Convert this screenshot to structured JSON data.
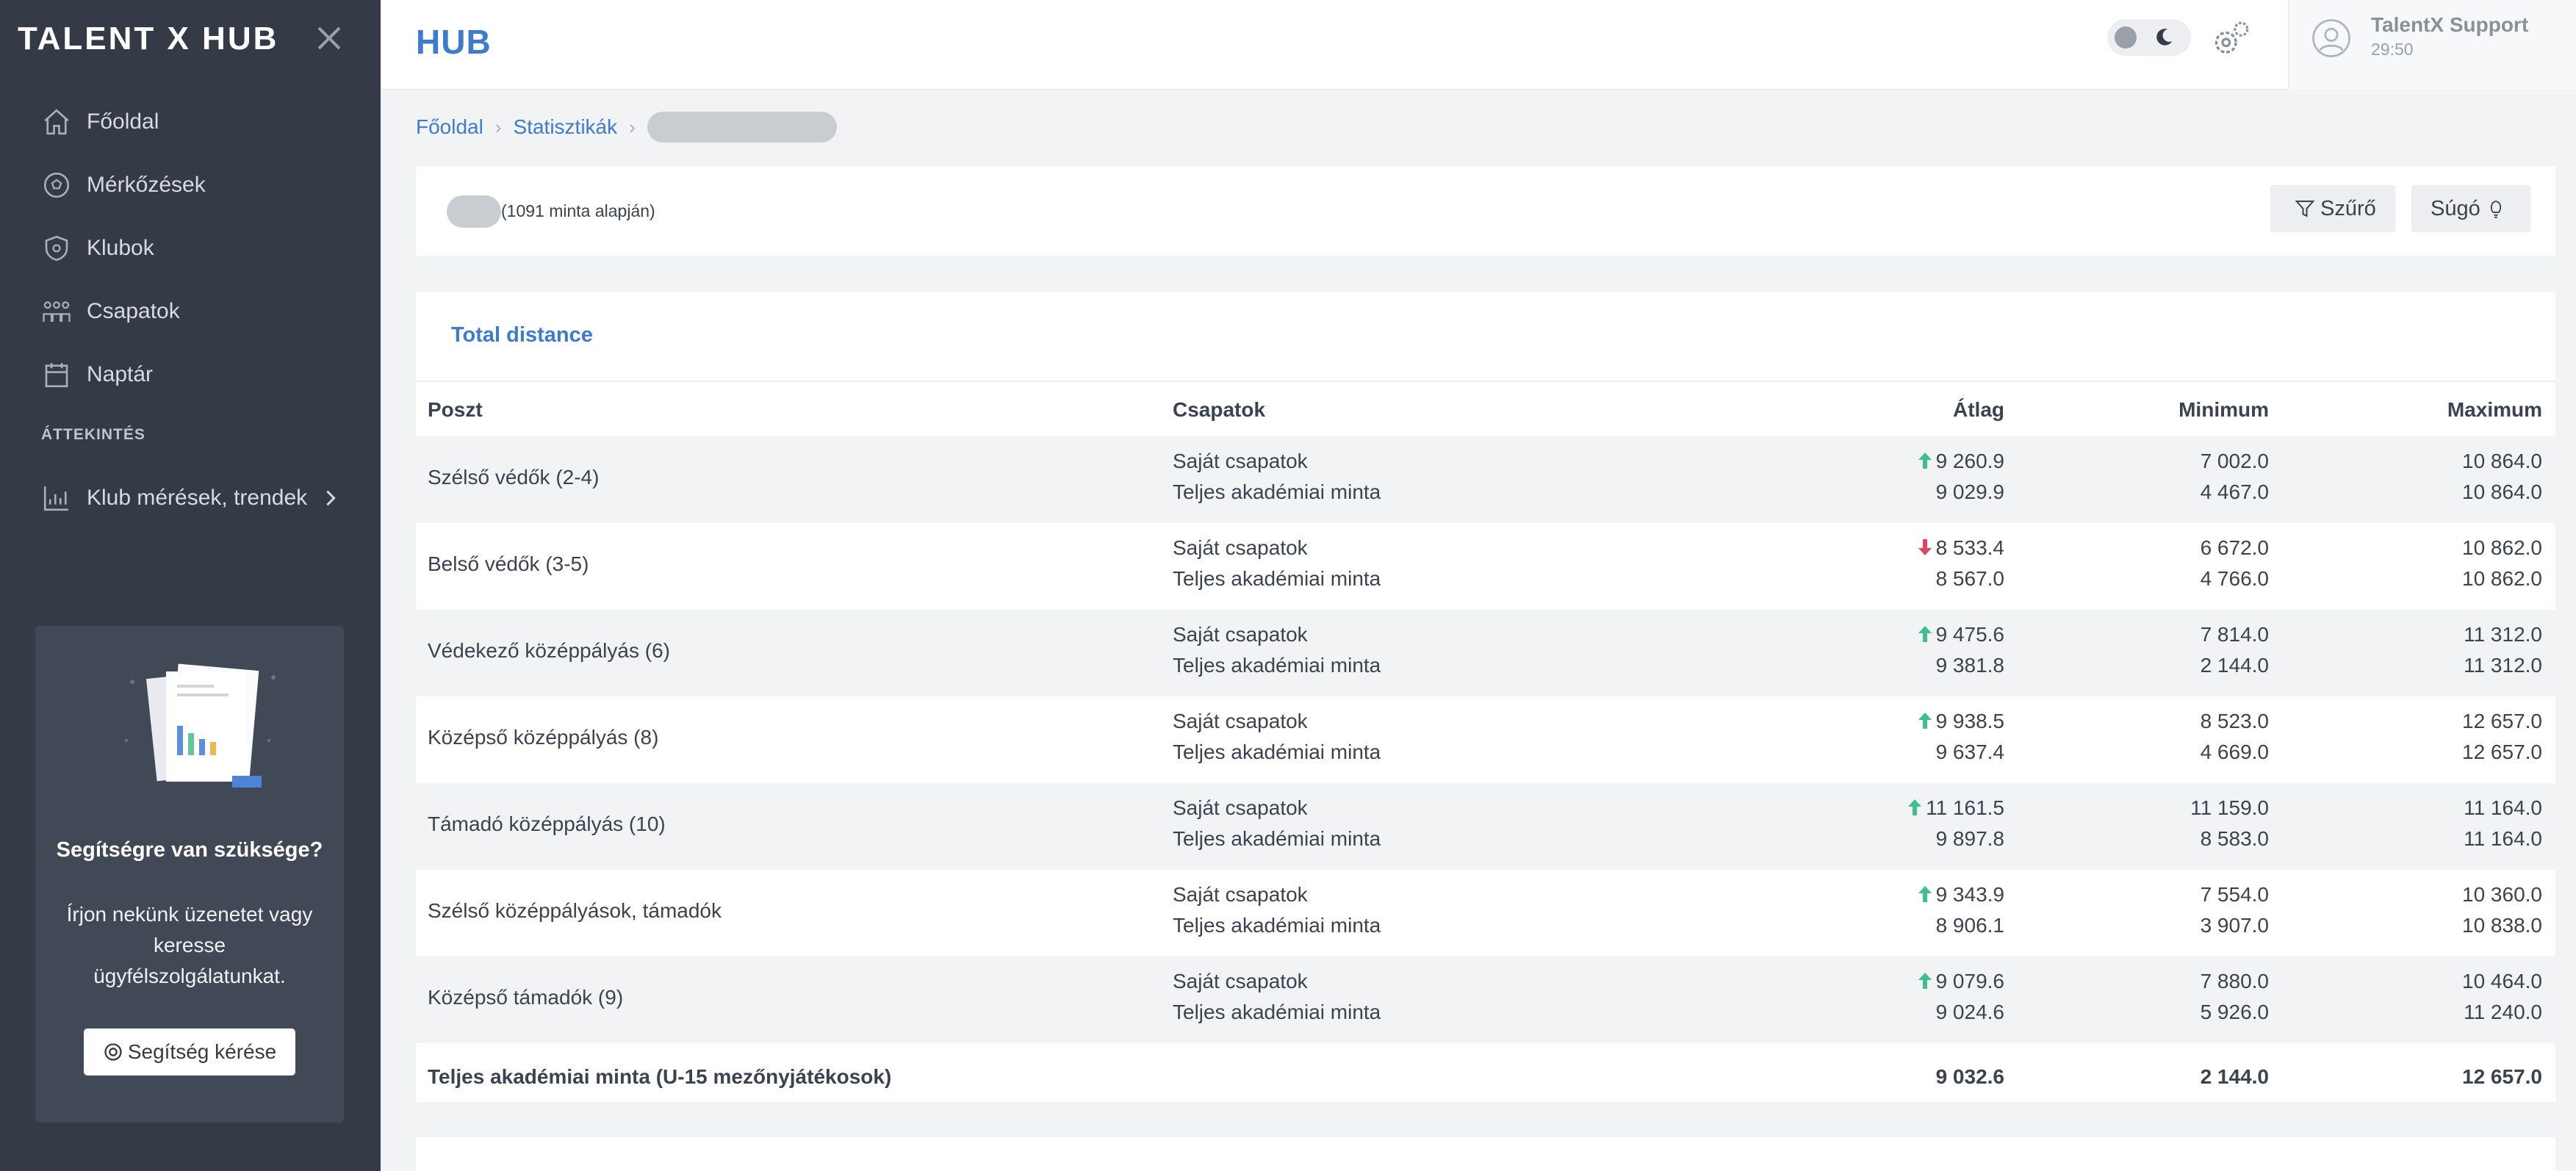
{
  "sidebar": {
    "logo": "TALENT X HUB",
    "nav": [
      {
        "label": "Főoldal",
        "icon": "home-icon"
      },
      {
        "label": "Mérkőzések",
        "icon": "ball-icon"
      },
      {
        "label": "Klubok",
        "icon": "shield-icon"
      },
      {
        "label": "Csapatok",
        "icon": "team-icon"
      },
      {
        "label": "Naptár",
        "icon": "calendar-icon"
      }
    ],
    "section_label": "ÁTTEKINTÉS",
    "overview_item": "Klub mérések, trendek",
    "help": {
      "title": "Segítségre van szüksége?",
      "text": "Írjon nekünk üzenetet vagy keresse ügyfélszolgálatunkat.",
      "button": "Segítség kérése"
    }
  },
  "header": {
    "logo": "HUB",
    "user_name": "TalentX Support",
    "user_time": "29:50"
  },
  "breadcrumb": [
    "Főoldal",
    "Statisztikák"
  ],
  "filterbar": {
    "sample_text": "(1091 minta alapján)",
    "filter_button": "Szűrő",
    "help_button": "Súgó"
  },
  "table": {
    "title": "Total distance",
    "headers": {
      "position": "Poszt",
      "teams": "Csapatok",
      "avg": "Átlag",
      "min": "Minimum",
      "max": "Maximum"
    },
    "team_labels": {
      "own": "Saját csapatok",
      "all": "Teljes akadémiai minta"
    },
    "rows": [
      {
        "position": "Szélső védők (2-4)",
        "trend": "up",
        "own": {
          "avg": "9 260.9",
          "min": "7 002.0",
          "max": "10 864.0"
        },
        "all": {
          "avg": "9 029.9",
          "min": "4 467.0",
          "max": "10 864.0"
        }
      },
      {
        "position": "Belső védők (3-5)",
        "trend": "down",
        "own": {
          "avg": "8 533.4",
          "min": "6 672.0",
          "max": "10 862.0"
        },
        "all": {
          "avg": "8 567.0",
          "min": "4 766.0",
          "max": "10 862.0"
        }
      },
      {
        "position": "Védekező középpályás (6)",
        "trend": "up",
        "own": {
          "avg": "9 475.6",
          "min": "7 814.0",
          "max": "11 312.0"
        },
        "all": {
          "avg": "9 381.8",
          "min": "2 144.0",
          "max": "11 312.0"
        }
      },
      {
        "position": "Középső középpályás (8)",
        "trend": "up",
        "own": {
          "avg": "9 938.5",
          "min": "8 523.0",
          "max": "12 657.0"
        },
        "all": {
          "avg": "9 637.4",
          "min": "4 669.0",
          "max": "12 657.0"
        }
      },
      {
        "position": "Támadó középpályás (10)",
        "trend": "up",
        "own": {
          "avg": "11 161.5",
          "min": "11 159.0",
          "max": "11 164.0"
        },
        "all": {
          "avg": "9 897.8",
          "min": "8 583.0",
          "max": "11 164.0"
        }
      },
      {
        "position": "Szélső középpályások, támadók",
        "trend": "up",
        "own": {
          "avg": "9 343.9",
          "min": "7 554.0",
          "max": "10 360.0"
        },
        "all": {
          "avg": "8 906.1",
          "min": "3 907.0",
          "max": "10 838.0"
        }
      },
      {
        "position": "Középső támadók (9)",
        "trend": "up",
        "own": {
          "avg": "9 079.6",
          "min": "7 880.0",
          "max": "10 464.0"
        },
        "all": {
          "avg": "9 024.6",
          "min": "5 926.0",
          "max": "11 240.0"
        }
      }
    ],
    "total": {
      "label": "Teljes akadémiai minta (U-15 mezőnyjátékosok)",
      "avg": "9 032.6",
      "min": "2 144.0",
      "max": "12 657.0"
    }
  },
  "colors": {
    "accent": "#3d7bd0",
    "up": "#3fbf8a",
    "down": "#e04460",
    "sidebar": "#343a46"
  }
}
